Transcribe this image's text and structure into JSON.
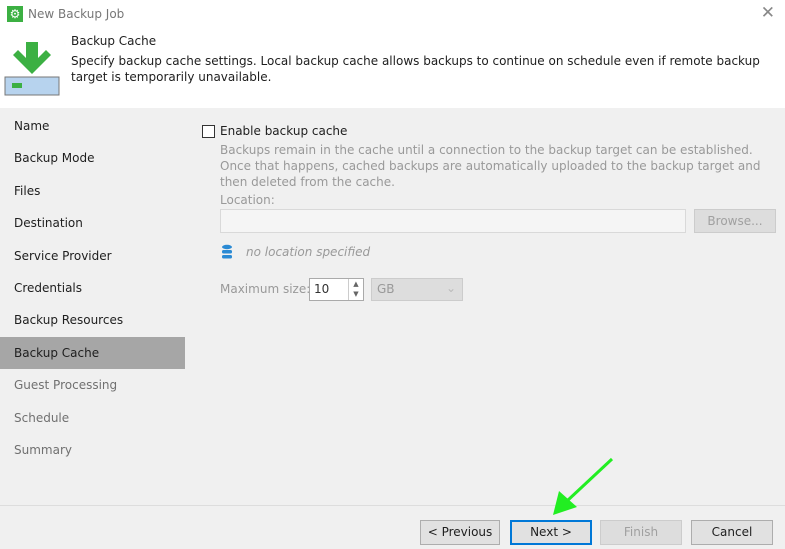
{
  "window": {
    "title": "New Backup Job",
    "close_icon": "close-icon"
  },
  "header": {
    "title": "Backup Cache",
    "description": "Specify backup cache settings. Local backup cache allows backups to continue on schedule even if remote backup target is temporarily unavailable."
  },
  "sidebar": {
    "items": [
      {
        "label": "Name"
      },
      {
        "label": "Backup Mode"
      },
      {
        "label": "Files"
      },
      {
        "label": "Destination"
      },
      {
        "label": "Service Provider"
      },
      {
        "label": "Credentials"
      },
      {
        "label": "Backup Resources"
      },
      {
        "label": "Backup Cache",
        "selected": true
      },
      {
        "label": "Guest Processing"
      },
      {
        "label": "Schedule"
      },
      {
        "label": "Summary"
      }
    ]
  },
  "main": {
    "enable_label": "Enable backup cache",
    "enable_checked": false,
    "help": "Backups remain in the cache until a connection to the backup target can be established. Once that happens, cached backups are automatically uploaded to the backup target and then deleted from the cache.",
    "location_label": "Location:",
    "location_value": "",
    "browse_label": "Browse...",
    "status": "no location specified",
    "max_size_label": "Maximum size:",
    "max_size_value": "10",
    "unit": "GB"
  },
  "footer": {
    "previous": "< Previous",
    "next": "Next >",
    "finish": "Finish",
    "cancel": "Cancel"
  },
  "colors": {
    "accent": "#0078d7",
    "selected_nav": "#a6a6a6",
    "annotation_arrow": "#22ee22"
  }
}
